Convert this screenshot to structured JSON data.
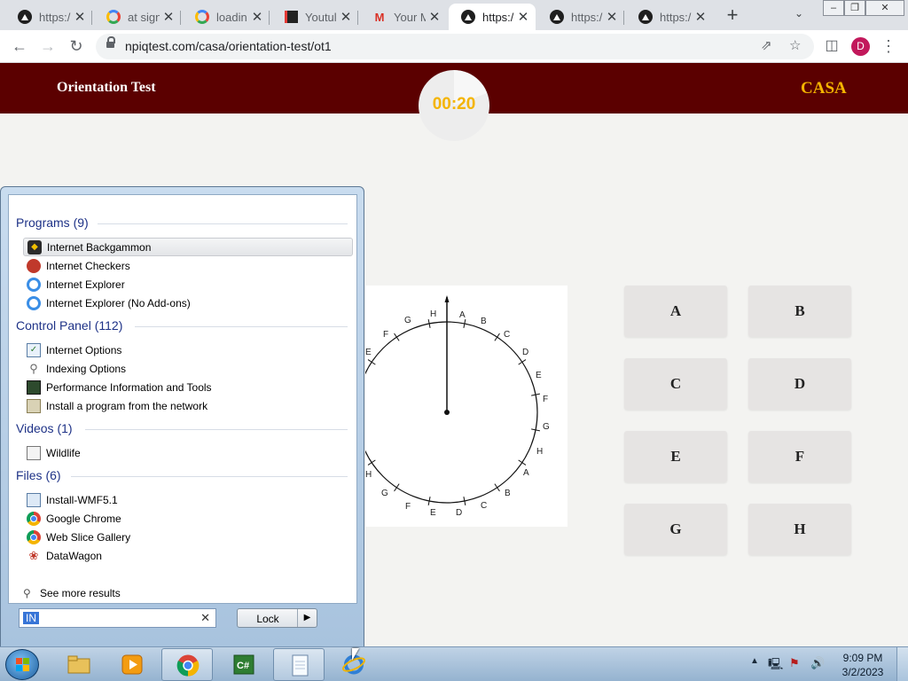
{
  "browser": {
    "tabs": [
      {
        "title": "https:/",
        "icon": "triangle-logo-icon",
        "active": false
      },
      {
        "title": "at sign",
        "icon": "google-icon",
        "active": false
      },
      {
        "title": "loadin",
        "icon": "google-icon",
        "active": false
      },
      {
        "title": "Youtul",
        "icon": "youtube-doc-icon",
        "active": false
      },
      {
        "title": "Your M",
        "icon": "gmail-icon",
        "active": false
      },
      {
        "title": "https:/",
        "icon": "triangle-logo-icon",
        "active": true
      },
      {
        "title": "https:/",
        "icon": "triangle-logo-icon",
        "active": false
      },
      {
        "title": "https:/",
        "icon": "triangle-logo-icon",
        "active": false
      }
    ],
    "tab_close": "✕",
    "new_tab": "+",
    "url": "npiqtest.com/casa/orientation-test/ot1",
    "profile_initial": "D"
  },
  "page": {
    "title": "Orientation Test",
    "brand": "CASA",
    "timer": "00:20",
    "dial": {
      "outer_labels": [
        "A",
        "B",
        "C",
        "D",
        "E",
        "F",
        "G",
        "H",
        "A",
        "B",
        "C",
        "D",
        "E",
        "F",
        "G",
        "H"
      ],
      "visible_outer_labels": [
        {
          "label": "A"
        },
        {
          "label": "B"
        },
        {
          "label": "C"
        },
        {
          "label": "D"
        },
        {
          "label": "E"
        },
        {
          "label": "F"
        },
        {
          "label": "G"
        },
        {
          "label": "H"
        },
        {
          "label": "A"
        },
        {
          "label": "B"
        },
        {
          "label": "C"
        },
        {
          "label": "D"
        },
        {
          "label": "E"
        },
        {
          "label": "F"
        },
        {
          "label": "G"
        },
        {
          "label": "H"
        },
        {
          "label": "G"
        },
        {
          "label": "F"
        },
        {
          "label": "E"
        },
        {
          "label": "H"
        }
      ]
    },
    "answers": [
      "A",
      "B",
      "C",
      "D",
      "E",
      "F",
      "G",
      "H"
    ]
  },
  "start_menu": {
    "groups": [
      {
        "heading": "Programs (9)",
        "items": [
          {
            "label": "Internet Backgammon",
            "icon": "backgammon-icon",
            "selected": true
          },
          {
            "label": "Internet Checkers",
            "icon": "checkers-icon"
          },
          {
            "label": "Internet Explorer",
            "icon": "ie-icon"
          },
          {
            "label": "Internet Explorer (No Add-ons)",
            "icon": "ie-icon"
          }
        ]
      },
      {
        "heading": "Control Panel (112)",
        "items": [
          {
            "label": "Internet Options",
            "icon": "internet-options-icon"
          },
          {
            "label": "Indexing Options",
            "icon": "indexing-icon"
          },
          {
            "label": "Performance Information and Tools",
            "icon": "performance-icon"
          },
          {
            "label": "Install a program from the network",
            "icon": "install-icon"
          }
        ]
      },
      {
        "heading": "Videos (1)",
        "items": [
          {
            "label": "Wildlife",
            "icon": "video-file-icon"
          }
        ]
      },
      {
        "heading": "Files (6)",
        "items": [
          {
            "label": "Install-WMF5.1",
            "icon": "installer-icon"
          },
          {
            "label": "Google Chrome",
            "icon": "chrome-icon"
          },
          {
            "label": "Web Slice Gallery",
            "icon": "chrome-icon"
          },
          {
            "label": "DataWagon",
            "icon": "datawagon-icon"
          }
        ]
      }
    ],
    "see_more": "See more results",
    "search_value": "IN",
    "lock_label": "Lock"
  },
  "taskbar": {
    "time": "9:09 PM",
    "date": "3/2/2023"
  }
}
